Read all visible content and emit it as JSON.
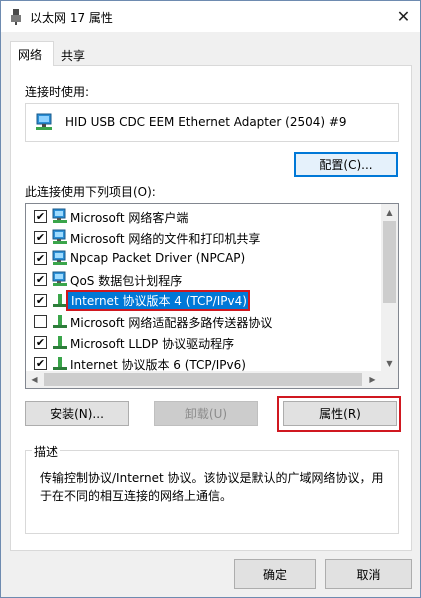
{
  "window": {
    "title": "以太网 17 属性",
    "close_glyph": "✕"
  },
  "tabs": [
    {
      "label": "网络",
      "active": true
    },
    {
      "label": "共享",
      "active": false
    }
  ],
  "connect_using": {
    "label": "连接时使用:",
    "adapter": "HID USB CDC EEM Ethernet Adapter (2504) #9"
  },
  "configure_button": "配置(C)...",
  "items_label": "此连接使用下列项目(O):",
  "items": [
    {
      "label": "Microsoft 网络客户端",
      "checked": true,
      "icon": "network-client-icon"
    },
    {
      "label": "Microsoft 网络的文件和打印机共享",
      "checked": true,
      "icon": "network-service-icon"
    },
    {
      "label": "Npcap Packet Driver (NPCAP)",
      "checked": true,
      "icon": "network-service-icon"
    },
    {
      "label": "QoS 数据包计划程序",
      "checked": true,
      "icon": "network-service-icon"
    },
    {
      "label": "Internet 协议版本 4 (TCP/IPv4)",
      "checked": true,
      "icon": "protocol-icon",
      "selected": true
    },
    {
      "label": "Microsoft 网络适配器多路传送器协议",
      "checked": false,
      "icon": "protocol-icon"
    },
    {
      "label": "Microsoft LLDP 协议驱动程序",
      "checked": true,
      "icon": "protocol-icon"
    },
    {
      "label": "Internet 协议版本 6 (TCP/IPv6)",
      "checked": true,
      "icon": "protocol-icon"
    }
  ],
  "buttons": {
    "install": "安装(N)...",
    "uninstall": "卸载(U)",
    "properties": "属性(R)",
    "ok": "确定",
    "cancel": "取消"
  },
  "description": {
    "legend": "描述",
    "text": "传输控制协议/Internet 协议。该协议是默认的广域网络协议，用于在不同的相互连接的网络上通信。"
  },
  "colors": {
    "accent": "#0078d7",
    "highlight_outline": "#d01820"
  }
}
